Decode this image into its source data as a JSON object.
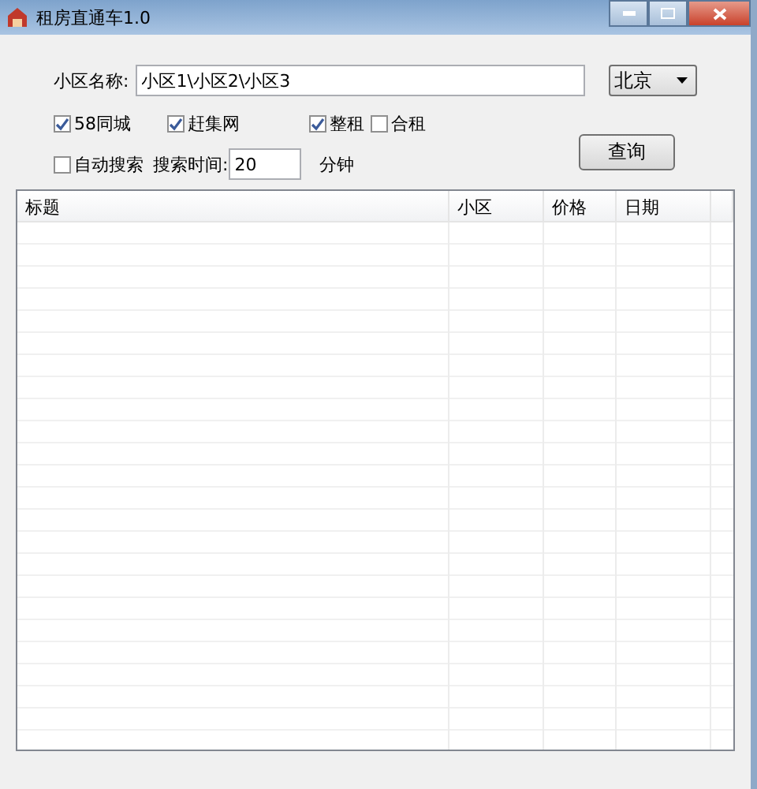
{
  "window": {
    "title": "租房直通车1.0"
  },
  "form": {
    "name_label": "小区名称:",
    "name_value": "小区1\\小区2\\小区3",
    "city": "北京",
    "sources": [
      {
        "label": "58同城",
        "checked": true
      },
      {
        "label": "赶集网",
        "checked": true
      }
    ],
    "rent_types": [
      {
        "label": "整租",
        "checked": true
      },
      {
        "label": "合租",
        "checked": false
      }
    ],
    "auto_search": {
      "label": "自动搜索",
      "checked": false
    },
    "interval_label": "搜索时间:",
    "interval_value": "20",
    "interval_unit": "分钟",
    "query_button": "查询"
  },
  "table": {
    "columns": [
      "标题",
      "小区",
      "价格",
      "日期"
    ]
  }
}
